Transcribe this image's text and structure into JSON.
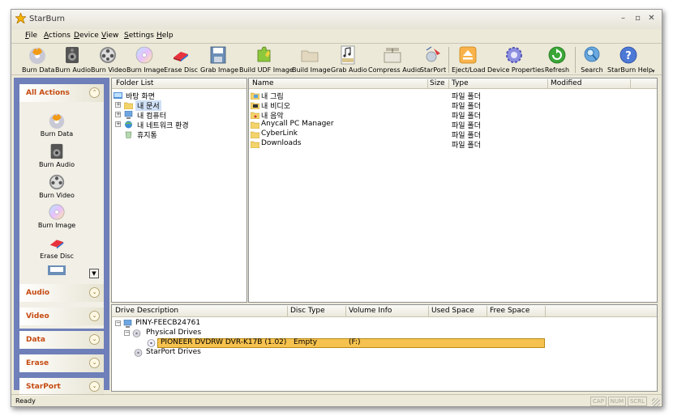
{
  "window": {
    "title": "StarBurn"
  },
  "menu": [
    "File",
    "Actions",
    "Device",
    "View",
    "Settings",
    "Help"
  ],
  "menu_underline": [
    "F",
    "A",
    "D",
    "V",
    "S",
    "H"
  ],
  "toolbar": [
    "Burn Data",
    "Burn Audio",
    "Burn Video",
    "Burn Image",
    "Erase Disc",
    "Grab Image",
    "Build UDF Image",
    "Build Image",
    "Grab Audio",
    "Compress Audio",
    "StarPort",
    "Eject/Load",
    "Device Properties",
    "Refresh",
    "Search",
    "StarBurn Help"
  ],
  "toolbar_overflow": "▾",
  "actions_panel": {
    "all_actions": {
      "title": "All Actions",
      "items": [
        "Burn Data",
        "Burn Audio",
        "Burn Video",
        "Burn Image",
        "Erase Disc"
      ]
    },
    "groups": [
      "Audio",
      "Video",
      "Data",
      "Erase",
      "StarPort"
    ],
    "collapse_glyph": "⌃",
    "expand_glyph": "⌄",
    "scroll_down_glyph": "▼"
  },
  "folder_list": {
    "header": "Folder List",
    "items": [
      {
        "label": "바탕 화면",
        "expander": ""
      },
      {
        "label": "내 문서",
        "expander": "+"
      },
      {
        "label": "내 컴퓨터",
        "expander": "+"
      },
      {
        "label": "내 네트워크 환경",
        "expander": "+"
      },
      {
        "label": "휴지통",
        "expander": ""
      }
    ]
  },
  "file_list": {
    "columns": [
      "Name",
      "Size",
      "Type",
      "Modified"
    ],
    "rows": [
      {
        "name": "내 그림",
        "size": "",
        "type": "파일 폴더",
        "modified": ""
      },
      {
        "name": "내 비디오",
        "size": "",
        "type": "파일 폴더",
        "modified": ""
      },
      {
        "name": "내 음악",
        "size": "",
        "type": "파일 폴더",
        "modified": ""
      },
      {
        "name": "Anycall PC Manager",
        "size": "",
        "type": "파일 폴더",
        "modified": ""
      },
      {
        "name": "CyberLink",
        "size": "",
        "type": "파일 폴더",
        "modified": ""
      },
      {
        "name": "Downloads",
        "size": "",
        "type": "파일 폴더",
        "modified": ""
      }
    ]
  },
  "drives": {
    "columns": [
      "Drive Description",
      "Disc Type",
      "Volume Info",
      "Used Space",
      "Free Space"
    ],
    "computer": "PINY-FEECB24761",
    "physical_label": "Physical Drives",
    "starport_label": "StarPort Drives",
    "drive": {
      "description": "PIONEER  DVDRW   DVR-K17B (1.02)",
      "disc_type": "Empty",
      "volume_info": "(F:)"
    },
    "expander_open": "−"
  },
  "status": {
    "text": "Ready",
    "indicators": [
      "CAP",
      "NUM",
      "SCRL"
    ]
  },
  "colors": {
    "accent_orange": "#c64b12",
    "selection": "#f6c24f",
    "panel_blue": "#6e7fb9"
  }
}
